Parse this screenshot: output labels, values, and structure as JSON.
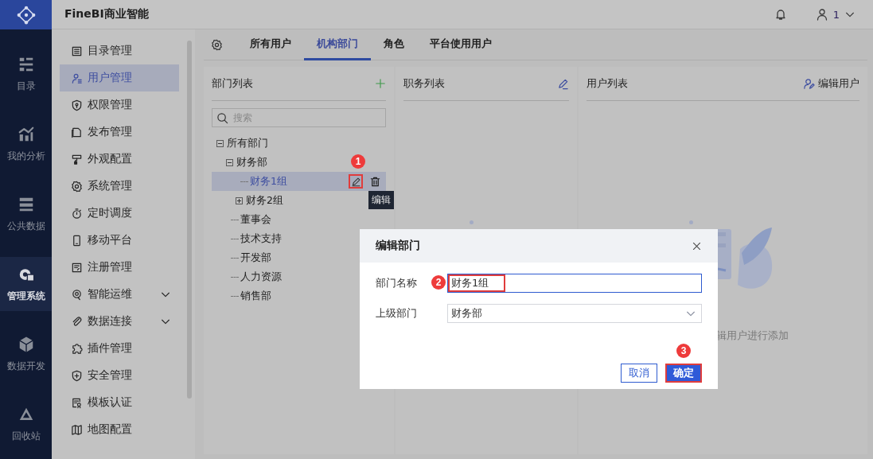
{
  "nav_rail": {
    "items": [
      {
        "label": "目录",
        "selected": false
      },
      {
        "label": "我的分析",
        "selected": false
      },
      {
        "label": "公共数据",
        "selected": false
      },
      {
        "label": "管理系统",
        "selected": true
      },
      {
        "label": "数据开发",
        "selected": false
      },
      {
        "label": "回收站",
        "selected": false
      }
    ]
  },
  "header": {
    "title": "FineBI商业智能",
    "user": "1"
  },
  "sidebar": {
    "items": [
      {
        "label": "目录管理",
        "selected": false
      },
      {
        "label": "用户管理",
        "selected": true
      },
      {
        "label": "权限管理",
        "selected": false
      },
      {
        "label": "发布管理",
        "selected": false
      },
      {
        "label": "外观配置",
        "selected": false
      },
      {
        "label": "系统管理",
        "selected": false
      },
      {
        "label": "定时调度",
        "selected": false
      },
      {
        "label": "移动平台",
        "selected": false
      },
      {
        "label": "注册管理",
        "selected": false
      },
      {
        "label": "智能运维",
        "selected": false,
        "expanded": false
      },
      {
        "label": "数据连接",
        "selected": false,
        "expanded": false
      },
      {
        "label": "插件管理",
        "selected": false
      },
      {
        "label": "安全管理",
        "selected": false
      },
      {
        "label": "模板认证",
        "selected": false
      },
      {
        "label": "地图配置",
        "selected": false
      }
    ]
  },
  "tabs": [
    {
      "label": "所有用户",
      "selected": false
    },
    {
      "label": "机构部门",
      "selected": true
    },
    {
      "label": "角色",
      "selected": false
    },
    {
      "label": "平台使用用户",
      "selected": false
    }
  ],
  "department_panel": {
    "title": "部门列表",
    "search": {
      "placeholder": "搜索"
    },
    "tree": [
      {
        "label": "所有部门",
        "selected": false,
        "expanded": true,
        "children": [
          {
            "label": "财务部",
            "selected": false,
            "expanded": true,
            "children": [
              {
                "label": "财务1组",
                "selected": true
              },
              {
                "label": "财务2组",
                "selected": false,
                "expanded": false
              }
            ]
          },
          {
            "label": "董事会",
            "selected": false
          },
          {
            "label": "技术支持",
            "selected": false
          },
          {
            "label": "开发部",
            "selected": false
          },
          {
            "label": "人力资源",
            "selected": false
          },
          {
            "label": "销售部",
            "selected": false
          }
        ]
      }
    ],
    "tooltip": "编辑"
  },
  "position_panel": {
    "title": "职务列表"
  },
  "user_panel": {
    "title": "用户列表",
    "edit_button": "编辑用户",
    "empty_text": "辑用户进行添加"
  },
  "dialog": {
    "title": "编辑部门",
    "fields": [
      {
        "label": "部门名称",
        "value": "财务1组",
        "kind": "text"
      },
      {
        "label": "上级部门",
        "value": "财务部",
        "kind": "select"
      }
    ],
    "buttons": [
      {
        "label": "取消",
        "kind": "secondary"
      },
      {
        "label": "确定",
        "kind": "primary"
      }
    ]
  },
  "annotations": [
    "1",
    "2",
    "3"
  ]
}
